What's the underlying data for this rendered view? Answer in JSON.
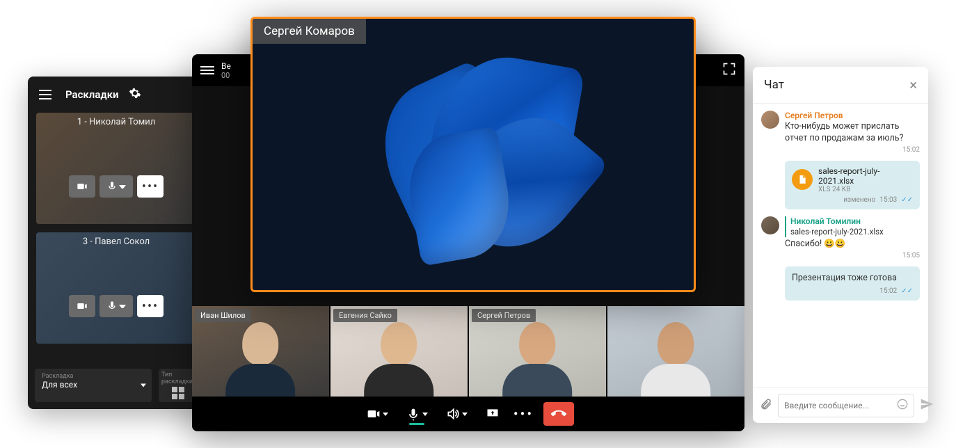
{
  "layouts": {
    "title": "Раскладки",
    "tiles": [
      {
        "label": "1 - Николай Томил"
      },
      {
        "label": "3 - Павел Сокол"
      }
    ],
    "footer": {
      "layout_label": "Раскладка",
      "layout_value": "Для всех",
      "type_label": "Тип раскладки"
    }
  },
  "conference": {
    "topbar_prefix": "Ве",
    "topbar_time": "00",
    "pinned_name": "Сергей Комаров",
    "thumbs": [
      {
        "name": "Иван Шилов"
      },
      {
        "name": "Евгения Сайко"
      },
      {
        "name": "Сергей Петров"
      },
      {
        "name": ""
      }
    ]
  },
  "chat": {
    "title": "Чат",
    "messages": [
      {
        "author": "Сергей Петров",
        "author_color": "orange",
        "text": "Кто-нибудь может прислать отчет по продажам за июль?",
        "time": "15:02"
      },
      {
        "type": "file",
        "file_name": "sales-report-july-2021.xlsx",
        "file_meta": "XLS 24 KB",
        "edited": "изменено",
        "time": "15:03"
      },
      {
        "author": "Николай Томилин",
        "author_color": "teal",
        "quote_file": "sales-report-july-2021.xlsx",
        "text": "Спасибо! 😀😀",
        "time": "15:05"
      },
      {
        "type": "bubble",
        "text": "Презентация тоже готова",
        "time": "15:02"
      }
    ],
    "input_placeholder": "Введите сообщение..."
  }
}
